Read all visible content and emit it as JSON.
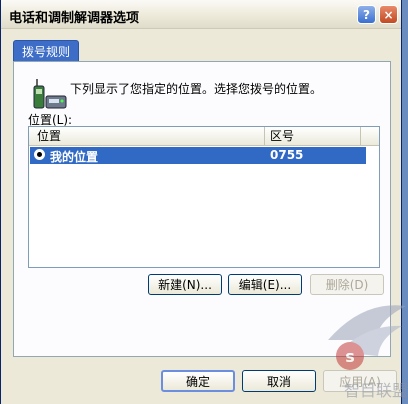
{
  "window": {
    "title": "电话和调制解调器选项",
    "help_glyph": "?",
    "close_glyph": "×"
  },
  "tabs": [
    {
      "label": "拨号规则"
    }
  ],
  "dialing": {
    "intro": "下列显示了您指定的位置。选择您拨号的位置。",
    "locations_label": "位置(L):",
    "columns": [
      "位置",
      "区号"
    ],
    "rows": [
      {
        "name": "我的位置",
        "area_code": "0755",
        "selected": true
      }
    ],
    "buttons": {
      "new": "新建(N)...",
      "edit": "编辑(E)...",
      "delete": "删除(D)"
    }
  },
  "footer": {
    "ok": "确定",
    "cancel": "取消",
    "apply": "应用(A)"
  },
  "watermark": "s 智目联盟"
}
